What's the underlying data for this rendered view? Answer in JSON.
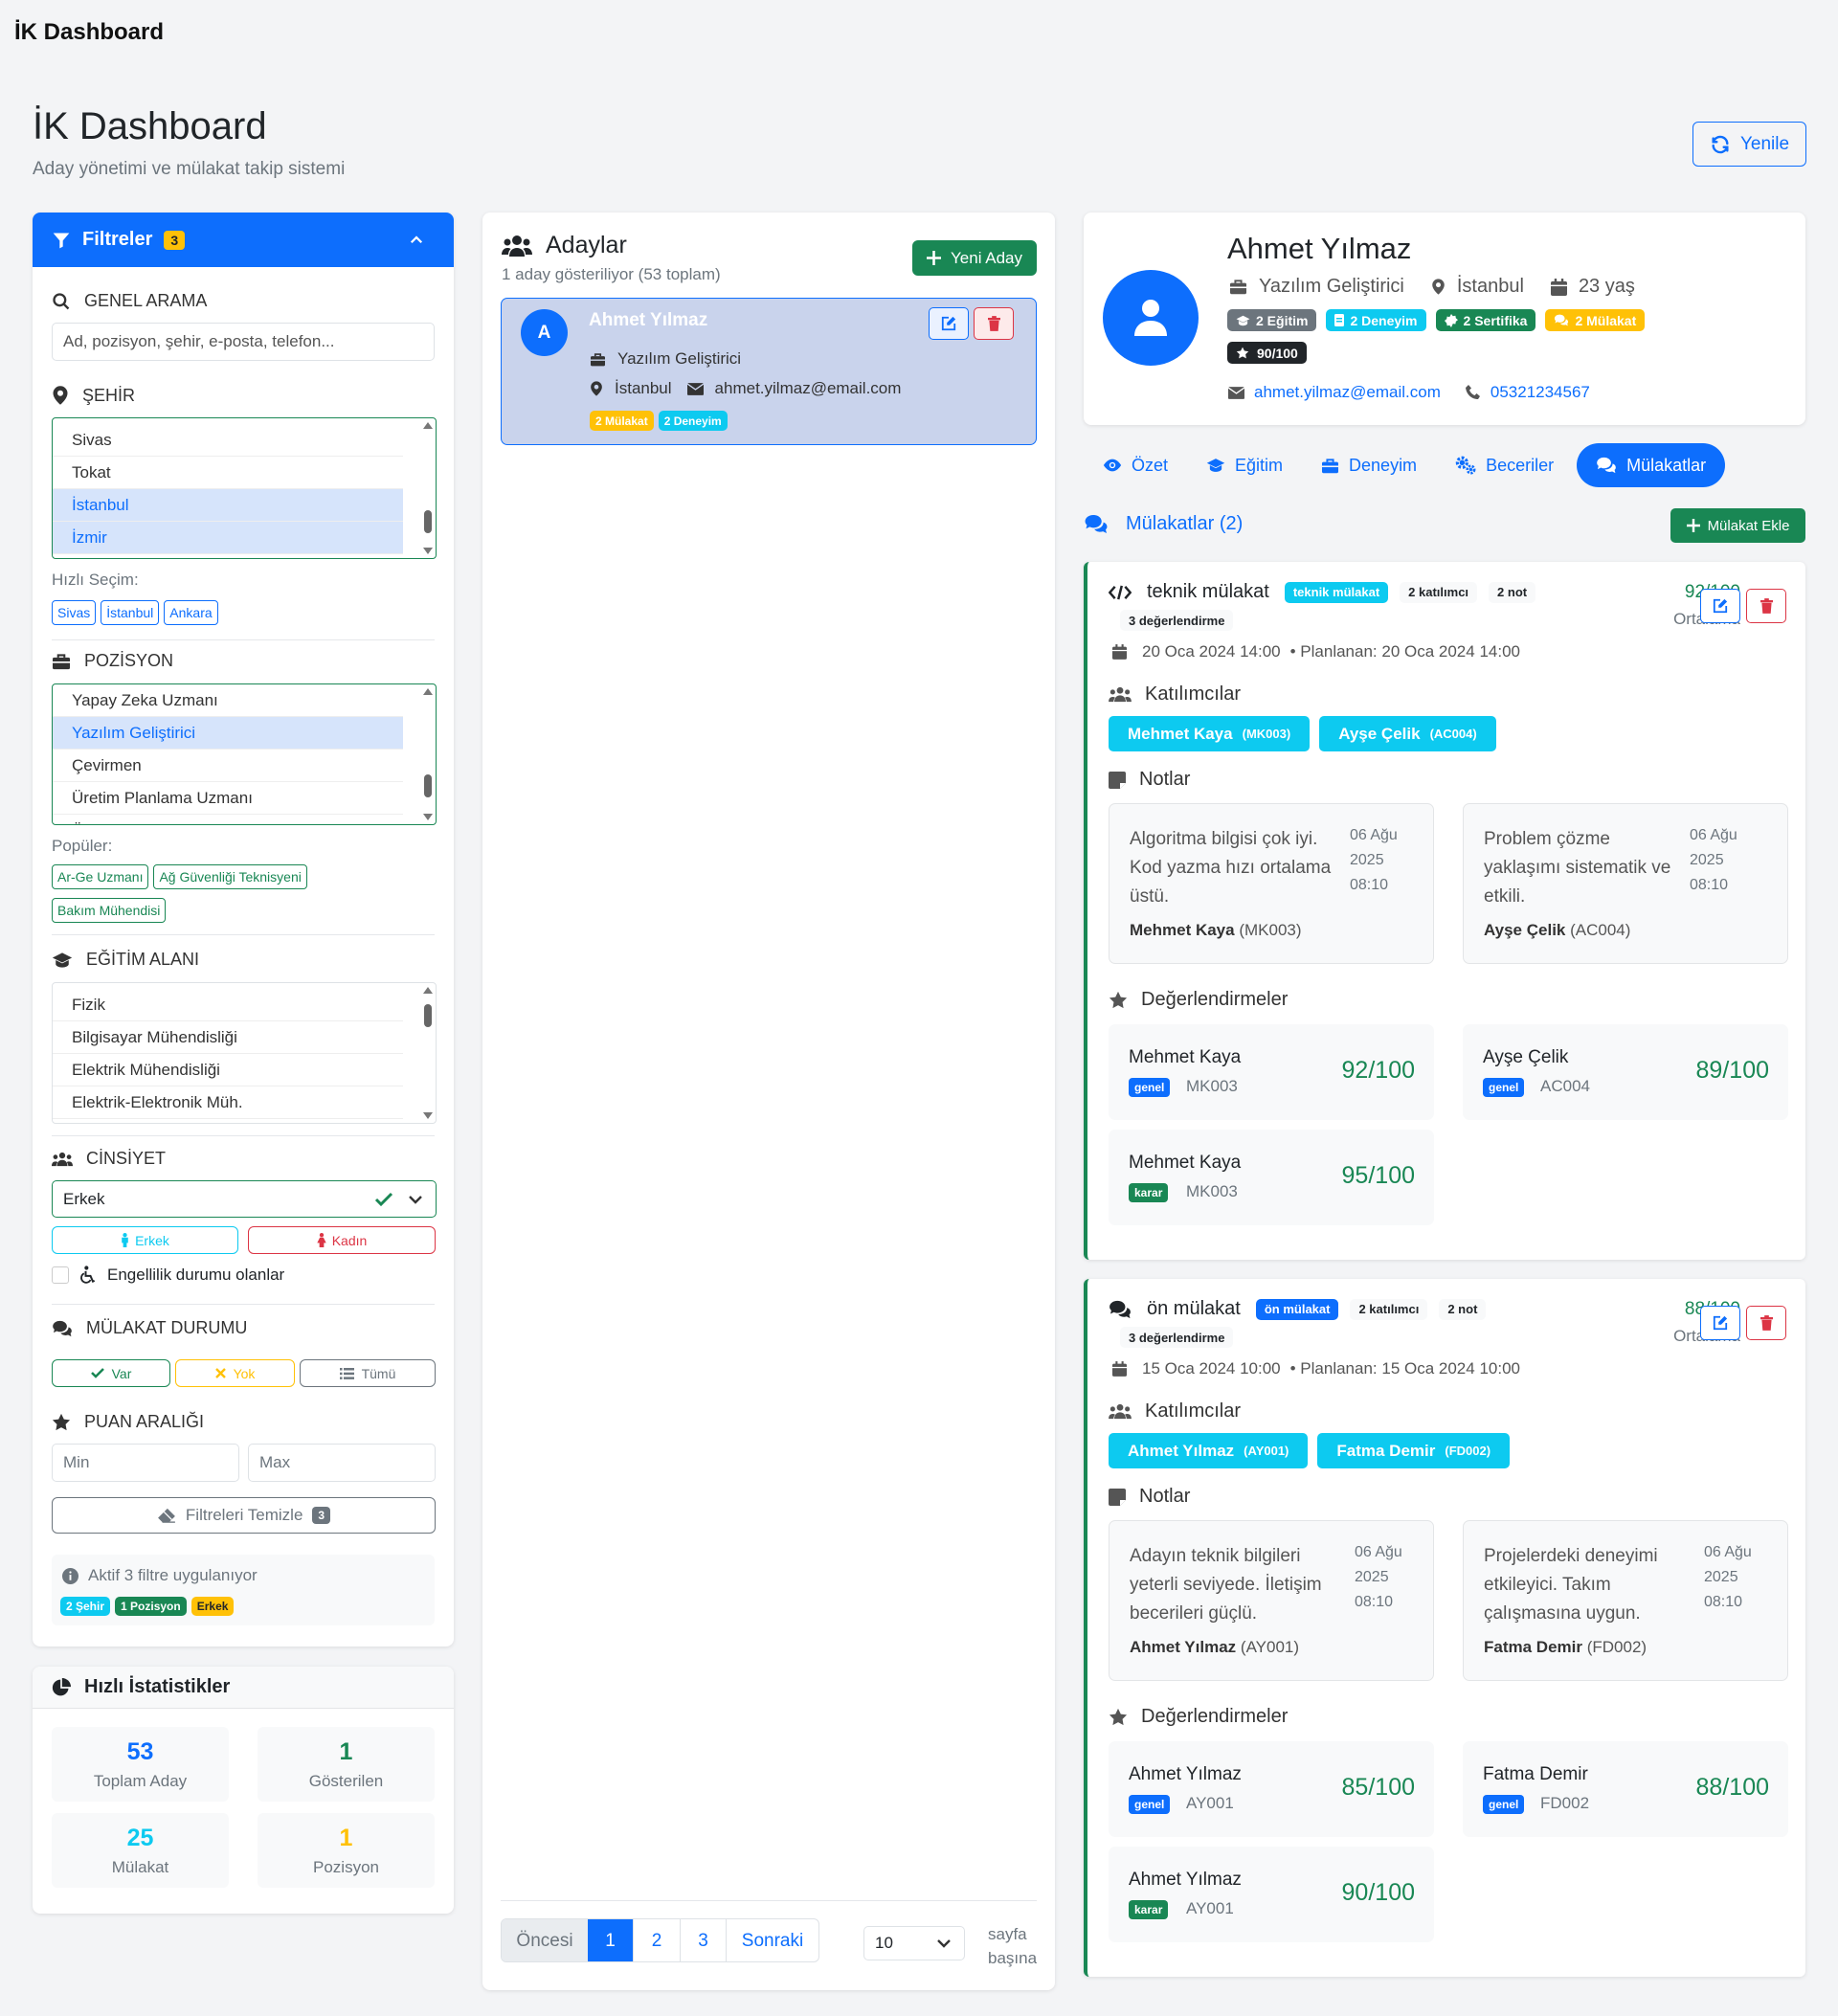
{
  "topbar": {
    "title": "İK Dashboard"
  },
  "header": {
    "title": "İK Dashboard",
    "subtitle": "Aday yönetimi ve mülakat takip sistemi",
    "refresh": "Yenile"
  },
  "filters": {
    "title": "Filtreler",
    "count": "3",
    "search": {
      "label": "GENEL ARAMA",
      "placeholder": "Ad, pozisyon, şehir, e-posta, telefon..."
    },
    "city": {
      "label": "ŞEHİR",
      "items": [
        {
          "label": "Sivas",
          "selected": false
        },
        {
          "label": "Tokat",
          "selected": false
        },
        {
          "label": "İstanbul",
          "selected": true
        },
        {
          "label": "İzmir",
          "selected": true
        }
      ],
      "quick_label": "Hızlı Seçim:",
      "quick": [
        "Sivas",
        "İstanbul",
        "Ankara"
      ]
    },
    "position": {
      "label": "POZİSYON",
      "items": [
        {
          "label": "Yapay Zeka Uzmanı",
          "selected": false
        },
        {
          "label": "Yazılım Geliştirici",
          "selected": true
        },
        {
          "label": "Çevirmen",
          "selected": false
        },
        {
          "label": "Üretim Planlama Uzmanı",
          "selected": false
        },
        {
          "label": "Ürün Geliştirme Uzmanı",
          "selected": false
        }
      ],
      "popular_label": "Popüler:",
      "popular": [
        "Ar-Ge Uzmanı",
        "Ağ Güvenliği Teknisyeni",
        "Bakım Mühendisi"
      ]
    },
    "education": {
      "label": "EĞİTİM ALANI",
      "items": [
        "Fizik",
        "Bilgisayar Mühendisliği",
        "Elektrik Mühendisliği",
        "Elektrik-Elektronik Müh."
      ]
    },
    "gender": {
      "label": "CİNSİYET",
      "value": "Erkek",
      "male": "Erkek",
      "female": "Kadın",
      "disability": "Engellilik durumu olanlar"
    },
    "interview": {
      "label": "MÜLAKAT DURUMU",
      "yes": "Var",
      "no": "Yok",
      "all": "Tümü"
    },
    "score": {
      "label": "PUAN ARALIĞI",
      "min_placeholder": "Min",
      "max_placeholder": "Max"
    },
    "clear": {
      "label": "Filtreleri Temizle",
      "count": "3"
    },
    "active": {
      "text": "Aktif 3 filtre uygulanıyor",
      "tags": [
        "2 Şehir",
        "1 Pozisyon",
        "Erkek"
      ]
    }
  },
  "stats": {
    "title": "Hızlı İstatistikler",
    "items": [
      {
        "value": "53",
        "label": "Toplam Aday",
        "color": "#0d6efd"
      },
      {
        "value": "1",
        "label": "Gösterilen",
        "color": "#198754"
      },
      {
        "value": "25",
        "label": "Mülakat",
        "color": "#0dcaf0"
      },
      {
        "value": "1",
        "label": "Pozisyon",
        "color": "#ffc107"
      }
    ]
  },
  "candidates": {
    "title": "Adaylar",
    "subtitle": "1 aday gösteriliyor (53 toplam)",
    "new_button": "Yeni Aday",
    "list": [
      {
        "initial": "A",
        "name": "Ahmet Yılmaz",
        "position": "Yazılım Geliştirici",
        "city": "İstanbul",
        "email": "ahmet.yilmaz@email.com",
        "badges": [
          "2 Mülakat",
          "2 Deneyim"
        ]
      }
    ],
    "pagination": {
      "prev": "Öncesi",
      "pages": [
        "1",
        "2",
        "3"
      ],
      "next": "Sonraki",
      "per_page": "10",
      "per_page_label": "sayfa başına"
    }
  },
  "profile": {
    "name": "Ahmet Yılmaz",
    "position": "Yazılım Geliştirici",
    "city": "İstanbul",
    "age": "23 yaş",
    "badges": [
      "2 Eğitim",
      "2 Deneyim",
      "2 Sertifika",
      "2 Mülakat"
    ],
    "score": "90/100",
    "email": "ahmet.yilmaz@email.com",
    "phone": "05321234567"
  },
  "tabs": [
    "Özet",
    "Eğitim",
    "Deneyim",
    "Beceriler",
    "Mülakatlar"
  ],
  "interviews": {
    "title": "Mülakatlar (2)",
    "add_button": "Mülakat Ekle",
    "labels": {
      "participants": "Katılımcılar",
      "notes": "Notlar",
      "evaluations": "Değerlendirmeler",
      "average": "Ortalama"
    },
    "items": [
      {
        "title": "teknik mülakat",
        "type": "teknik mülakat",
        "participants_count": "2 katılımcı",
        "notes_count": "2 not",
        "evaluations_count": "3 değerlendirme",
        "score": "92/100",
        "date": "20 Oca 2024 14:00",
        "planned": "• Planlanan: 20 Oca 2024 14:00",
        "participants": [
          {
            "name": "Mehmet Kaya",
            "code": "(MK003)"
          },
          {
            "name": "Ayşe Çelik",
            "code": "(AC004)"
          }
        ],
        "notes": [
          {
            "text": "Algoritma bilgisi çok iyi. Kod yazma hızı ortalama üstü.",
            "date": "06 Ağu 2025 08:10",
            "author": "Mehmet Kaya",
            "code": "(MK003)"
          },
          {
            "text": "Problem çözme yaklaşımı sistematik ve etkili.",
            "date": "06 Ağu 2025 08:10",
            "author": "Ayşe Çelik",
            "code": "(AC004)"
          }
        ],
        "evaluations": [
          {
            "name": "Mehmet Kaya",
            "tag": "genel",
            "code": "MK003",
            "score": "92/100"
          },
          {
            "name": "Ayşe Çelik",
            "tag": "genel",
            "code": "AC004",
            "score": "89/100"
          },
          {
            "name": "Mehmet Kaya",
            "tag": "karar",
            "code": "MK003",
            "score": "95/100"
          }
        ]
      },
      {
        "title": "ön mülakat",
        "type": "ön mülakat",
        "participants_count": "2 katılımcı",
        "notes_count": "2 not",
        "evaluations_count": "3 değerlendirme",
        "score": "88/100",
        "date": "15 Oca 2024 10:00",
        "planned": "• Planlanan: 15 Oca 2024 10:00",
        "participants": [
          {
            "name": "Ahmet Yılmaz",
            "code": "(AY001)"
          },
          {
            "name": "Fatma Demir",
            "code": "(FD002)"
          }
        ],
        "notes": [
          {
            "text": "Adayın teknik bilgileri yeterli seviyede. İletişim becerileri güçlü.",
            "date": "06 Ağu 2025 08:10",
            "author": "Ahmet Yılmaz",
            "code": "(AY001)"
          },
          {
            "text": "Projelerdeki deneyimi etkileyici. Takım çalışmasına uygun.",
            "date": "06 Ağu 2025 08:10",
            "author": "Fatma Demir",
            "code": "(FD002)"
          }
        ],
        "evaluations": [
          {
            "name": "Ahmet Yılmaz",
            "tag": "genel",
            "code": "AY001",
            "score": "85/100"
          },
          {
            "name": "Fatma Demir",
            "tag": "genel",
            "code": "FD002",
            "score": "88/100"
          },
          {
            "name": "Ahmet Yılmaz",
            "tag": "karar",
            "code": "AY001",
            "score": "90/100"
          }
        ]
      }
    ]
  },
  "colors": {
    "primary": "#0d6efd",
    "success": "#198754",
    "info": "#0dcaf0",
    "warning": "#ffc107",
    "danger": "#dc3545"
  }
}
